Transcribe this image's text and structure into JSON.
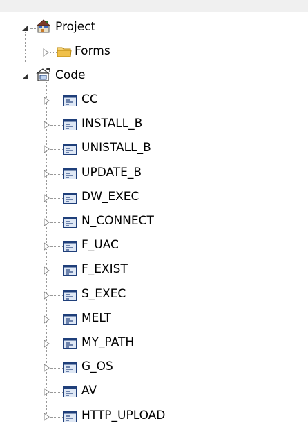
{
  "tree": {
    "project": {
      "label": "Project"
    },
    "forms": {
      "label": "Forms"
    },
    "code": {
      "label": "Code"
    },
    "modules": [
      {
        "label": "CC"
      },
      {
        "label": "INSTALL_B"
      },
      {
        "label": "UNISTALL_B"
      },
      {
        "label": "UPDATE_B"
      },
      {
        "label": "DW_EXEC"
      },
      {
        "label": "N_CONNECT"
      },
      {
        "label": "F_UAC"
      },
      {
        "label": "F_EXIST"
      },
      {
        "label": "S_EXEC"
      },
      {
        "label": "MELT"
      },
      {
        "label": "MY_PATH"
      },
      {
        "label": "G_OS"
      },
      {
        "label": "AV"
      },
      {
        "label": "HTTP_UPLOAD"
      }
    ]
  },
  "colors": {
    "folder": "#f0c04a",
    "module_border": "#1f3f7a",
    "module_fill": "#dfe8f5",
    "connector": "#999999"
  },
  "icons": {
    "project": "project-icon",
    "folder": "folder-icon",
    "code": "code-icon",
    "module": "module-icon",
    "expanded": "triangle-expanded-icon",
    "collapsed": "triangle-collapsed-icon"
  }
}
